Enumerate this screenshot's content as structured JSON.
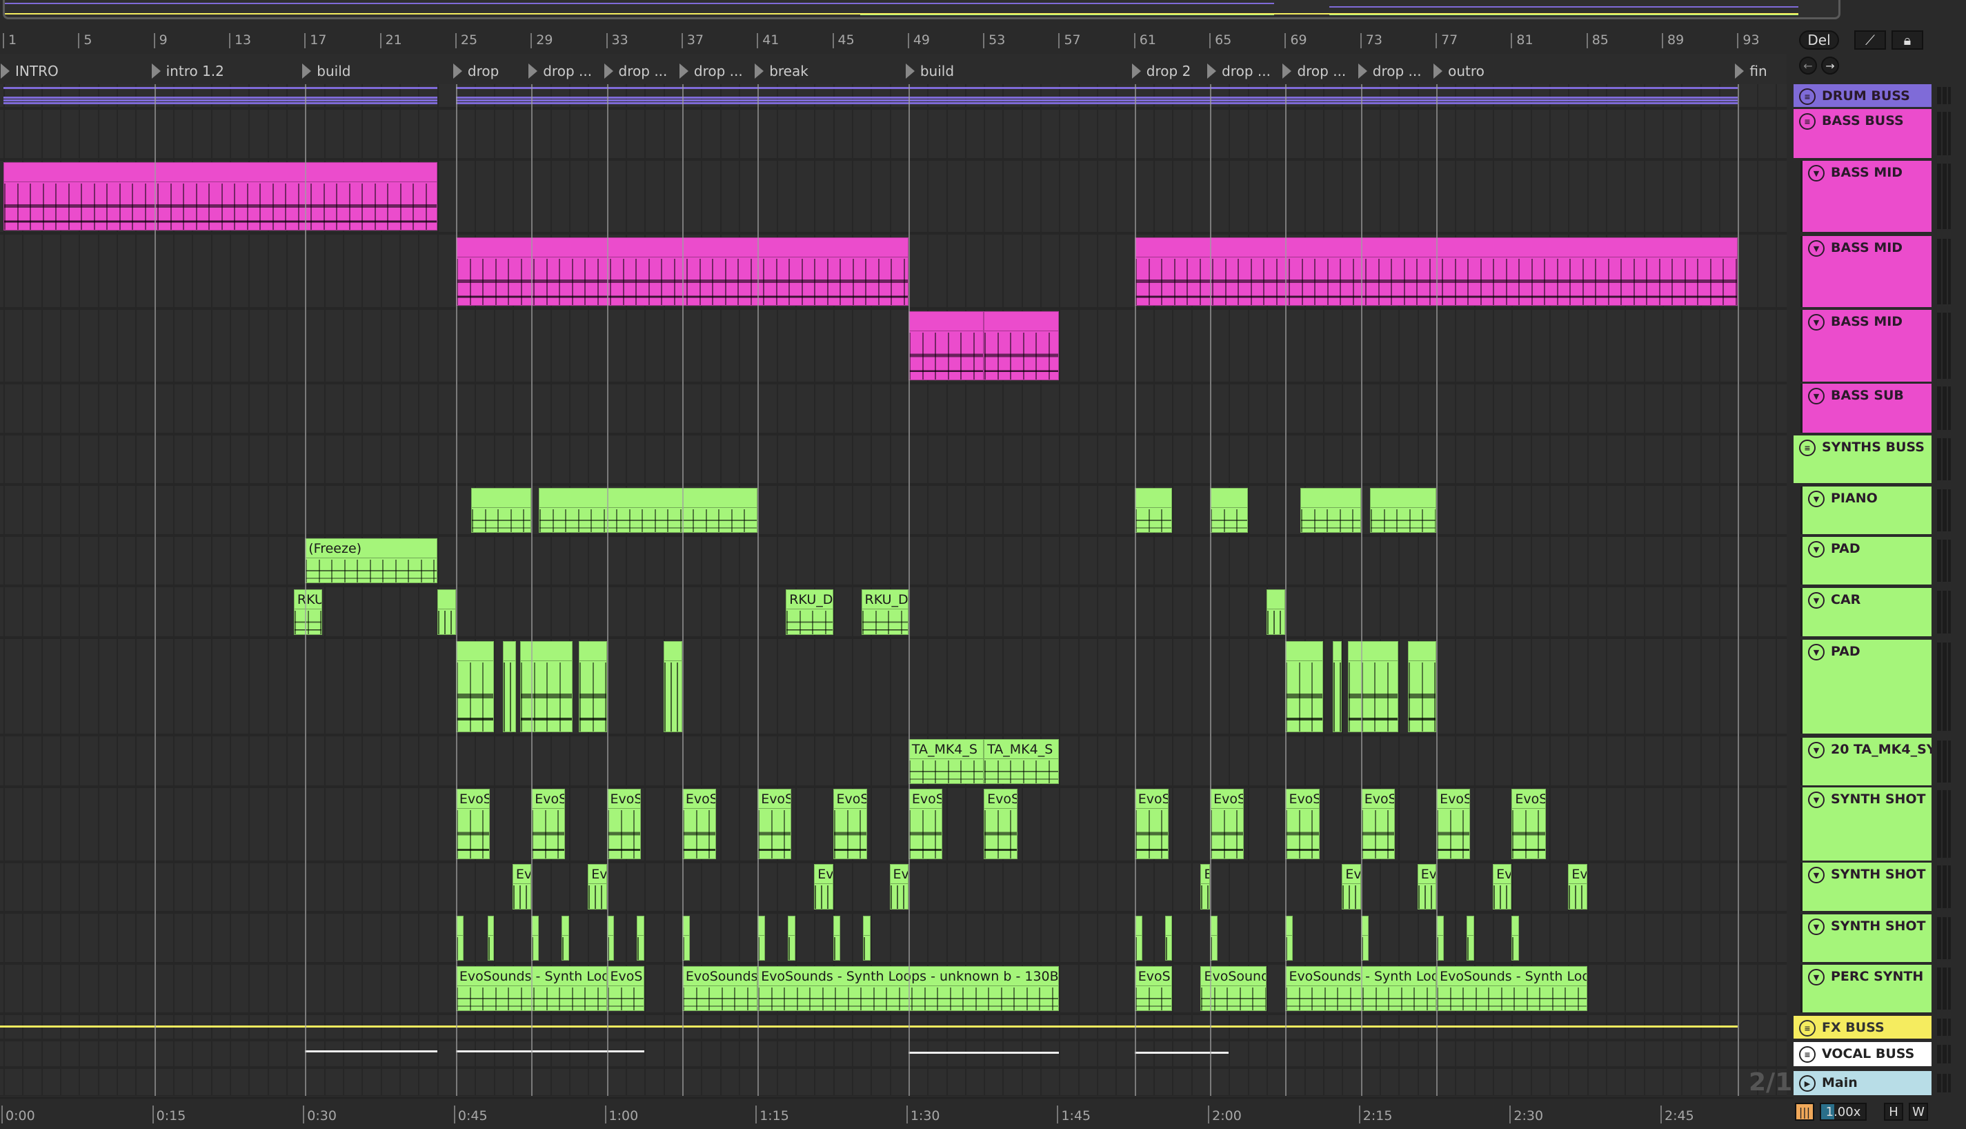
{
  "colors": {
    "pink": "#eb4ccc",
    "green": "#a5f57a",
    "purple": "#7f6bd8",
    "yellow": "#f5ec5f",
    "white": "#ffffff",
    "blue": "#b8dde7",
    "bg": "#2e2e2e"
  },
  "ruler": {
    "bars": [
      1,
      5,
      9,
      13,
      17,
      21,
      25,
      29,
      33,
      37,
      41,
      45,
      49,
      53,
      57,
      61,
      65,
      69,
      73,
      77,
      81,
      85,
      89,
      93
    ]
  },
  "locators": [
    {
      "bar": 1,
      "label": "INTRO"
    },
    {
      "bar": 9,
      "label": "intro 1.2"
    },
    {
      "bar": 17,
      "label": "build"
    },
    {
      "bar": 25,
      "label": "drop"
    },
    {
      "bar": 29,
      "label": "drop ..."
    },
    {
      "bar": 33,
      "label": "drop ..."
    },
    {
      "bar": 37,
      "label": "drop ..."
    },
    {
      "bar": 41,
      "label": "break"
    },
    {
      "bar": 49,
      "label": "build"
    },
    {
      "bar": 61,
      "label": "drop 2"
    },
    {
      "bar": 65,
      "label": "drop ..."
    },
    {
      "bar": 69,
      "label": "drop ..."
    },
    {
      "bar": 73,
      "label": "drop ..."
    },
    {
      "bar": 77,
      "label": "outro"
    },
    {
      "bar": 93,
      "label": "fin"
    }
  ],
  "controls": {
    "delete_label": "Del",
    "prev_icon": "arrow-left-icon",
    "next_icon": "arrow-right-icon",
    "link_icon": "link-icon",
    "lock_icon": "lock-icon"
  },
  "tracks": [
    {
      "name": "DRUM BUSS",
      "color": "purple",
      "icon": "group-icon",
      "child": false,
      "clips": []
    },
    {
      "name": "BASS BUSS",
      "color": "pink",
      "icon": "group-icon",
      "child": false,
      "clips": []
    },
    {
      "name": "BASS MID",
      "color": "pink",
      "icon": "fold-icon",
      "child": true,
      "clips": [
        {
          "s": 1,
          "e": 24,
          "l": ""
        }
      ]
    },
    {
      "name": "BASS MID",
      "color": "pink",
      "icon": "fold-icon",
      "child": true,
      "clips": [
        {
          "s": 25,
          "e": 49,
          "l": ""
        },
        {
          "s": 61,
          "e": 93,
          "l": ""
        }
      ]
    },
    {
      "name": "BASS MID",
      "color": "pink",
      "icon": "fold-icon",
      "child": true,
      "clips": [
        {
          "s": 49,
          "e": 53,
          "l": ""
        },
        {
          "s": 53,
          "e": 57,
          "l": ""
        }
      ]
    },
    {
      "name": "BASS SUB",
      "color": "pink",
      "icon": "fold-icon",
      "child": true,
      "clips": []
    },
    {
      "name": "SYNTHS BUSS",
      "color": "green",
      "icon": "group-icon",
      "child": false,
      "clips": []
    },
    {
      "name": "PIANO",
      "color": "green",
      "icon": "fold-icon",
      "child": true,
      "clips": [
        {
          "s": 25.8,
          "e": 29,
          "l": ""
        },
        {
          "s": 29.4,
          "e": 41,
          "l": ""
        },
        {
          "s": 61,
          "e": 63,
          "l": ""
        },
        {
          "s": 65,
          "e": 67,
          "l": ""
        },
        {
          "s": 69.8,
          "e": 73,
          "l": ""
        },
        {
          "s": 73.5,
          "e": 77,
          "l": ""
        }
      ]
    },
    {
      "name": "PAD",
      "color": "green",
      "icon": "fold-icon",
      "child": true,
      "clips": [
        {
          "s": 17,
          "e": 24,
          "l": "(Freeze)"
        }
      ]
    },
    {
      "name": "CAR",
      "color": "green",
      "icon": "fold-icon",
      "child": true,
      "clips": [
        {
          "s": 16.4,
          "e": 17.9,
          "l": "RKU"
        },
        {
          "s": 24,
          "e": 25,
          "l": ""
        },
        {
          "s": 42.5,
          "e": 45,
          "l": "RKU_D"
        },
        {
          "s": 46.5,
          "e": 49,
          "l": "RKU_D"
        },
        {
          "s": 68,
          "e": 69,
          "l": ""
        }
      ]
    },
    {
      "name": "PAD",
      "color": "green",
      "icon": "fold-icon",
      "child": true,
      "clips": [
        {
          "s": 25,
          "e": 27,
          "l": ""
        },
        {
          "s": 27.5,
          "e": 28.2,
          "l": ""
        },
        {
          "s": 28.4,
          "e": 31.2,
          "l": ""
        },
        {
          "s": 31.5,
          "e": 33,
          "l": ""
        },
        {
          "s": 36,
          "e": 37,
          "l": ""
        },
        {
          "s": 69,
          "e": 71,
          "l": ""
        },
        {
          "s": 71.5,
          "e": 72,
          "l": ""
        },
        {
          "s": 72.3,
          "e": 75,
          "l": ""
        },
        {
          "s": 75.5,
          "e": 77,
          "l": ""
        }
      ]
    },
    {
      "name": "20 TA_MK4_SY",
      "color": "green",
      "icon": "fold-icon",
      "child": true,
      "clips": [
        {
          "s": 49,
          "e": 53,
          "l": "TA_MK4_S"
        },
        {
          "s": 53,
          "e": 57,
          "l": "TA_MK4_S"
        }
      ]
    },
    {
      "name": "SYNTH SHOT",
      "color": "green",
      "icon": "fold-icon",
      "child": true,
      "clips": [
        {
          "s": 25,
          "e": 26.8,
          "l": "EvoS"
        },
        {
          "s": 29,
          "e": 30.8,
          "l": "EvoS"
        },
        {
          "s": 33,
          "e": 34.8,
          "l": "EvoS"
        },
        {
          "s": 37,
          "e": 38.8,
          "l": "EvoS"
        },
        {
          "s": 41,
          "e": 42.8,
          "l": "EvoS"
        },
        {
          "s": 45,
          "e": 46.8,
          "l": "EvoS"
        },
        {
          "s": 49,
          "e": 50.8,
          "l": "EvoS"
        },
        {
          "s": 53,
          "e": 54.8,
          "l": "EvoS"
        },
        {
          "s": 61,
          "e": 62.8,
          "l": "EvoS"
        },
        {
          "s": 65,
          "e": 66.8,
          "l": "EvoS"
        },
        {
          "s": 69,
          "e": 70.8,
          "l": "EvoS"
        },
        {
          "s": 73,
          "e": 74.8,
          "l": "EvoS"
        },
        {
          "s": 77,
          "e": 78.8,
          "l": "EvoS"
        },
        {
          "s": 81,
          "e": 82.8,
          "l": "EvoS"
        }
      ]
    },
    {
      "name": "SYNTH SHOT",
      "color": "green",
      "icon": "fold-icon",
      "child": true,
      "clips": [
        {
          "s": 28,
          "e": 29,
          "l": "Ev"
        },
        {
          "s": 32,
          "e": 33,
          "l": "Ev"
        },
        {
          "s": 44,
          "e": 45,
          "l": "Ev"
        },
        {
          "s": 48,
          "e": 49,
          "l": "Ev"
        },
        {
          "s": 64.5,
          "e": 65,
          "l": "E"
        },
        {
          "s": 72,
          "e": 73,
          "l": "Ev"
        },
        {
          "s": 76,
          "e": 77,
          "l": "Ev"
        },
        {
          "s": 80,
          "e": 81,
          "l": "Ev"
        },
        {
          "s": 84,
          "e": 85,
          "l": "Ev"
        }
      ]
    },
    {
      "name": "SYNTH SHOT",
      "color": "green",
      "icon": "fold-icon",
      "child": true,
      "clips": [
        {
          "s": 25,
          "e": 25.4,
          "l": ""
        },
        {
          "s": 26.7,
          "e": 27,
          "l": ""
        },
        {
          "s": 29,
          "e": 29.4,
          "l": ""
        },
        {
          "s": 30.6,
          "e": 31,
          "l": ""
        },
        {
          "s": 33,
          "e": 33.4,
          "l": ""
        },
        {
          "s": 34.6,
          "e": 35,
          "l": ""
        },
        {
          "s": 37,
          "e": 37.4,
          "l": ""
        },
        {
          "s": 41,
          "e": 41.4,
          "l": ""
        },
        {
          "s": 42.6,
          "e": 43,
          "l": ""
        },
        {
          "s": 45,
          "e": 45.4,
          "l": ""
        },
        {
          "s": 46.6,
          "e": 47,
          "l": ""
        },
        {
          "s": 61,
          "e": 61.4,
          "l": ""
        },
        {
          "s": 62.6,
          "e": 63,
          "l": ""
        },
        {
          "s": 65,
          "e": 65.4,
          "l": ""
        },
        {
          "s": 69,
          "e": 69.4,
          "l": ""
        },
        {
          "s": 73,
          "e": 73.4,
          "l": ""
        },
        {
          "s": 77,
          "e": 77.4,
          "l": ""
        },
        {
          "s": 78.6,
          "e": 79,
          "l": ""
        },
        {
          "s": 81,
          "e": 81.4,
          "l": ""
        }
      ]
    },
    {
      "name": "PERC SYNTH",
      "color": "green",
      "icon": "fold-icon",
      "child": true,
      "clips": [
        {
          "s": 25,
          "e": 33,
          "l": "EvoSounds - Synth Loo"
        },
        {
          "s": 33,
          "e": 35,
          "l": "EvoS"
        },
        {
          "s": 37,
          "e": 41,
          "l": "EvoSounds"
        },
        {
          "s": 41,
          "e": 57,
          "l": "EvoSounds - Synth Loops - unknown b - 130B"
        },
        {
          "s": 61,
          "e": 63,
          "l": "EvoS"
        },
        {
          "s": 64.5,
          "e": 68,
          "l": "EvoSound"
        },
        {
          "s": 69,
          "e": 77,
          "l": "EvoSounds - Synth Loo"
        },
        {
          "s": 77,
          "e": 85,
          "l": "EvoSounds - Synth Loo"
        }
      ]
    },
    {
      "name": "FX BUSS",
      "color": "yellow",
      "icon": "group-icon",
      "child": false,
      "clips": []
    },
    {
      "name": "VOCAL BUSS",
      "color": "white",
      "icon": "group-icon",
      "child": false,
      "clips": []
    },
    {
      "name": "Main",
      "color": "blue",
      "icon": "play-icon",
      "child": false,
      "clips": []
    }
  ],
  "timeline": {
    "labels": [
      "0:00",
      "0:15",
      "0:30",
      "0:45",
      "1:00",
      "1:15",
      "1:30",
      "1:45",
      "2:00",
      "2:15",
      "2:30",
      "2:45"
    ]
  },
  "time_signature": "2/1",
  "footer": {
    "zoom": "1.00x",
    "h_label": "H",
    "w_label": "W",
    "waveform_icon": "waveform-icon"
  }
}
